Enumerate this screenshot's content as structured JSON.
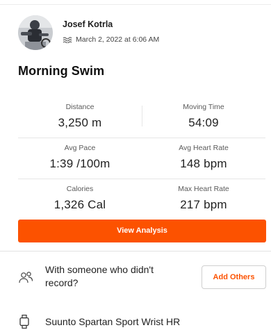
{
  "header": {
    "user_name": "Josef Kotrla",
    "date": "March 2, 2022 at 6:06 AM",
    "activity_icon": "swim-icon"
  },
  "activity": {
    "title": "Morning Swim"
  },
  "stats": [
    {
      "label": "Distance",
      "value": "3,250 m"
    },
    {
      "label": "Moving Time",
      "value": "54:09"
    },
    {
      "label": "Avg Pace",
      "value": "1:39 /100m"
    },
    {
      "label": "Avg Heart Rate",
      "value": "148 bpm"
    },
    {
      "label": "Calories",
      "value": "1,326 Cal"
    },
    {
      "label": "Max Heart Rate",
      "value": "217 bpm"
    }
  ],
  "actions": {
    "view_analysis_label": "View Analysis"
  },
  "others": {
    "icon": "people-icon",
    "text": "With someone who didn't record?",
    "button_label": "Add Others"
  },
  "device": {
    "icon": "watch-icon",
    "name": "Suunto Spartan Sport Wrist HR"
  },
  "colors": {
    "accent": "#fc5200",
    "text": "#1a1a1a",
    "muted": "#5a5a5a",
    "divider": "#e6e6e6"
  }
}
